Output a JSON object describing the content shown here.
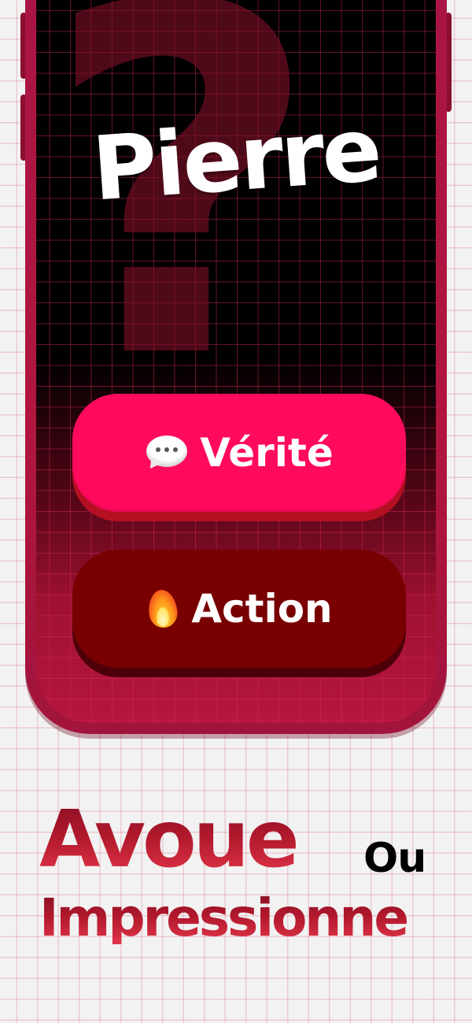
{
  "player": {
    "name": "Pierre"
  },
  "background_symbol": "?",
  "choices": [
    {
      "id": "truth",
      "label": "Vérité",
      "icon": "speech-bubble-icon",
      "color": "#ff0a5c"
    },
    {
      "id": "dare",
      "label": "Action",
      "icon": "fire-icon",
      "color": "#780000"
    }
  ],
  "tagline": {
    "word1": "Avoue",
    "connector": "Ou",
    "word2": "Impressionne"
  },
  "colors": {
    "page_background": "#f2f2f2",
    "phone_frame": "#b0163f",
    "screen_background": "#000000",
    "truth_button": "#ff0a5c",
    "dare_button": "#780000",
    "tagline": "#b0182c"
  }
}
